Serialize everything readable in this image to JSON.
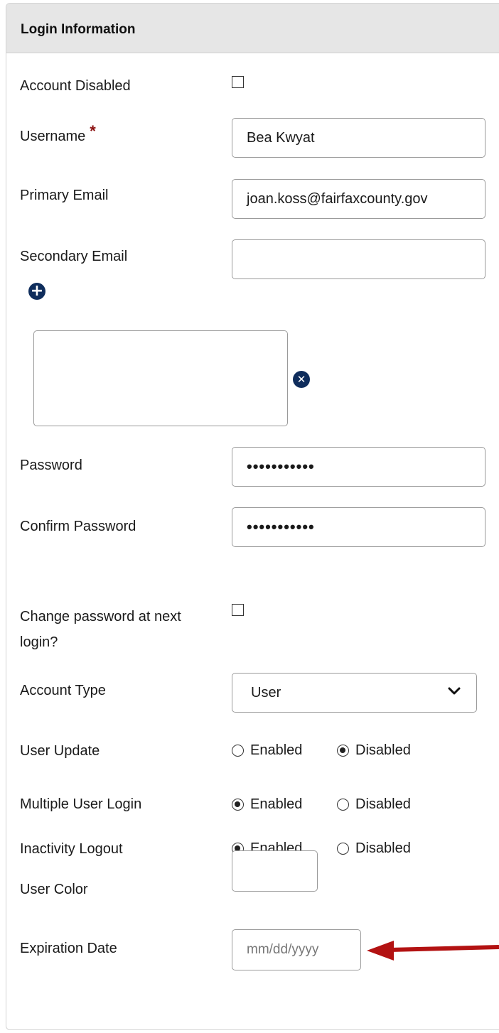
{
  "section": {
    "title": "Login Information"
  },
  "fields": {
    "account_disabled": {
      "label": "Account Disabled",
      "checked": false
    },
    "username": {
      "label": "Username",
      "required_mark": "*",
      "value": "Bea Kwyat"
    },
    "primary_email": {
      "label": "Primary Email",
      "value": "joan.koss@fairfaxcounty.gov"
    },
    "secondary_email": {
      "label": "Secondary Email",
      "value": ""
    },
    "password": {
      "label": "Password",
      "value": "•••••••••••"
    },
    "confirm_password": {
      "label": "Confirm Password",
      "value": "•••••••••••"
    },
    "change_password": {
      "label_line1": "Change password at next",
      "label_line2": "login?",
      "checked": false
    },
    "account_type": {
      "label": "Account Type",
      "value": "User"
    },
    "user_update": {
      "label": "User Update",
      "options": [
        "Enabled",
        "Disabled"
      ],
      "selected": "Disabled"
    },
    "multiple_user_login": {
      "label": "Multiple User Login",
      "options": [
        "Enabled",
        "Disabled"
      ],
      "selected": "Enabled"
    },
    "inactivity_logout": {
      "label": "Inactivity Logout",
      "options": [
        "Enabled",
        "Disabled"
      ],
      "selected": "Enabled"
    },
    "user_color": {
      "label": "User Color",
      "value": ""
    },
    "expiration_date": {
      "label": "Expiration Date",
      "placeholder": "mm/dd/yyyy"
    }
  },
  "icons": {
    "add_email": "plus-circle-icon",
    "remove_email": "x-circle-icon",
    "dropdown": "chevron-down-icon",
    "annotation": "red-arrow"
  },
  "colors": {
    "header_bg": "#e6e6e6",
    "required": "#8b1010",
    "icon": "#0f2d5c",
    "annotation_arrow": "#b31212"
  }
}
